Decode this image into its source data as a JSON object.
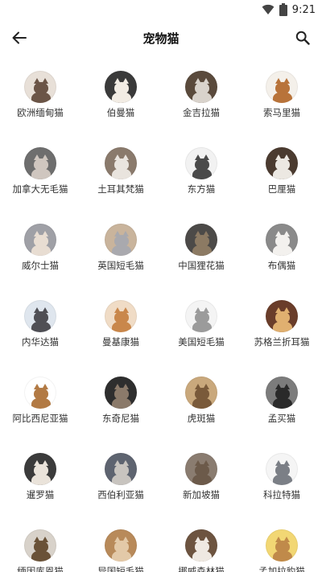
{
  "status_bar": {
    "time": "9:21"
  },
  "app_bar": {
    "title": "宠物猫"
  },
  "breeds": [
    {
      "name": "欧洲缅甸猫",
      "bg": "#e8e0d8",
      "cat": "#6b5547"
    },
    {
      "name": "伯曼猫",
      "bg": "#3a3a3a",
      "cat": "#f2ece4"
    },
    {
      "name": "金吉拉猫",
      "bg": "#5a4a3c",
      "cat": "#d9d3cc"
    },
    {
      "name": "索马里猫",
      "bg": "#f4f0ea",
      "cat": "#b8733a"
    },
    {
      "name": "加拿大无毛猫",
      "bg": "#6e6e6e",
      "cat": "#cfc6bf"
    },
    {
      "name": "土耳其梵猫",
      "bg": "#8a7a6c",
      "cat": "#e9e4de"
    },
    {
      "name": "东方猫",
      "bg": "#f2f2f2",
      "cat": "#4a4a4a"
    },
    {
      "name": "巴厘猫",
      "bg": "#4b3b30",
      "cat": "#ece8e2"
    },
    {
      "name": "威尔士猫",
      "bg": "#9fa0a6",
      "cat": "#e8ddd2"
    },
    {
      "name": "英国短毛猫",
      "bg": "#c9b49c",
      "cat": "#a9a9ae"
    },
    {
      "name": "中国狸花猫",
      "bg": "#4c4a48",
      "cat": "#8c7a63"
    },
    {
      "name": "布偶猫",
      "bg": "#8a8a8a",
      "cat": "#f3f1ee"
    },
    {
      "name": "内华达猫",
      "bg": "#dfe6ee",
      "cat": "#4f4f55"
    },
    {
      "name": "曼基康猫",
      "bg": "#f0dcc6",
      "cat": "#c9874b"
    },
    {
      "name": "美国短毛猫",
      "bg": "#f4f4f4",
      "cat": "#9b9b9b"
    },
    {
      "name": "苏格兰折耳猫",
      "bg": "#6a3d2a",
      "cat": "#e0b070"
    },
    {
      "name": "阿比西尼亚猫",
      "bg": "#ffffff",
      "cat": "#b27a44"
    },
    {
      "name": "东奇尼猫",
      "bg": "#2e2e2e",
      "cat": "#8b7a6a"
    },
    {
      "name": "虎斑猫",
      "bg": "#c9a87c",
      "cat": "#7a5a3a"
    },
    {
      "name": "孟买猫",
      "bg": "#7c7c7c",
      "cat": "#2a2a2a"
    },
    {
      "name": "暹罗猫",
      "bg": "#3b3b3b",
      "cat": "#eae3da"
    },
    {
      "name": "西伯利亚猫",
      "bg": "#5e6470",
      "cat": "#c8c4bf"
    },
    {
      "name": "新加坡猫",
      "bg": "#8a7c70",
      "cat": "#6c5a4a"
    },
    {
      "name": "科拉特猫",
      "bg": "#f5f5f5",
      "cat": "#7b7f86"
    },
    {
      "name": "缅因库恩猫",
      "bg": "#d8d2ca",
      "cat": "#6a5238"
    },
    {
      "name": "异国短毛猫",
      "bg": "#b88a5a",
      "cat": "#e3c9a8"
    },
    {
      "name": "挪威森林猫",
      "bg": "#6d5440",
      "cat": "#efe9e2"
    },
    {
      "name": "孟加拉豹猫",
      "bg": "#f2d774",
      "cat": "#c08a4a"
    }
  ]
}
